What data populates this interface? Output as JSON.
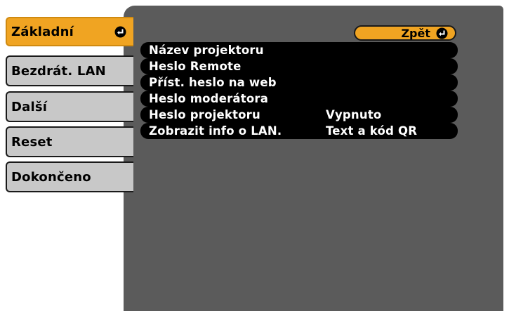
{
  "sidebar": {
    "items": [
      {
        "label": "Základní",
        "selected": true,
        "icon": "enter-icon"
      },
      {
        "label": "Bezdrát. LAN"
      },
      {
        "label": "Další"
      },
      {
        "label": "Reset"
      },
      {
        "label": "Dokončeno"
      }
    ]
  },
  "main": {
    "back_label": "Zpět",
    "back_icon": "enter-icon",
    "rows": [
      {
        "label": "Název projektoru",
        "value": ""
      },
      {
        "label": "Heslo Remote",
        "value": ""
      },
      {
        "label": "Příst. heslo na web",
        "value": ""
      },
      {
        "label": "Heslo moderátora",
        "value": ""
      },
      {
        "label": "Heslo projektoru",
        "value": "Vypnuto"
      },
      {
        "label": "Zobrazit info o LAN.",
        "value": "Text a kód QR"
      }
    ]
  },
  "colors": {
    "accent": "#f0a422",
    "panel": "#5b5b5b",
    "tab": "#c8c8c8",
    "row": "#000000"
  }
}
